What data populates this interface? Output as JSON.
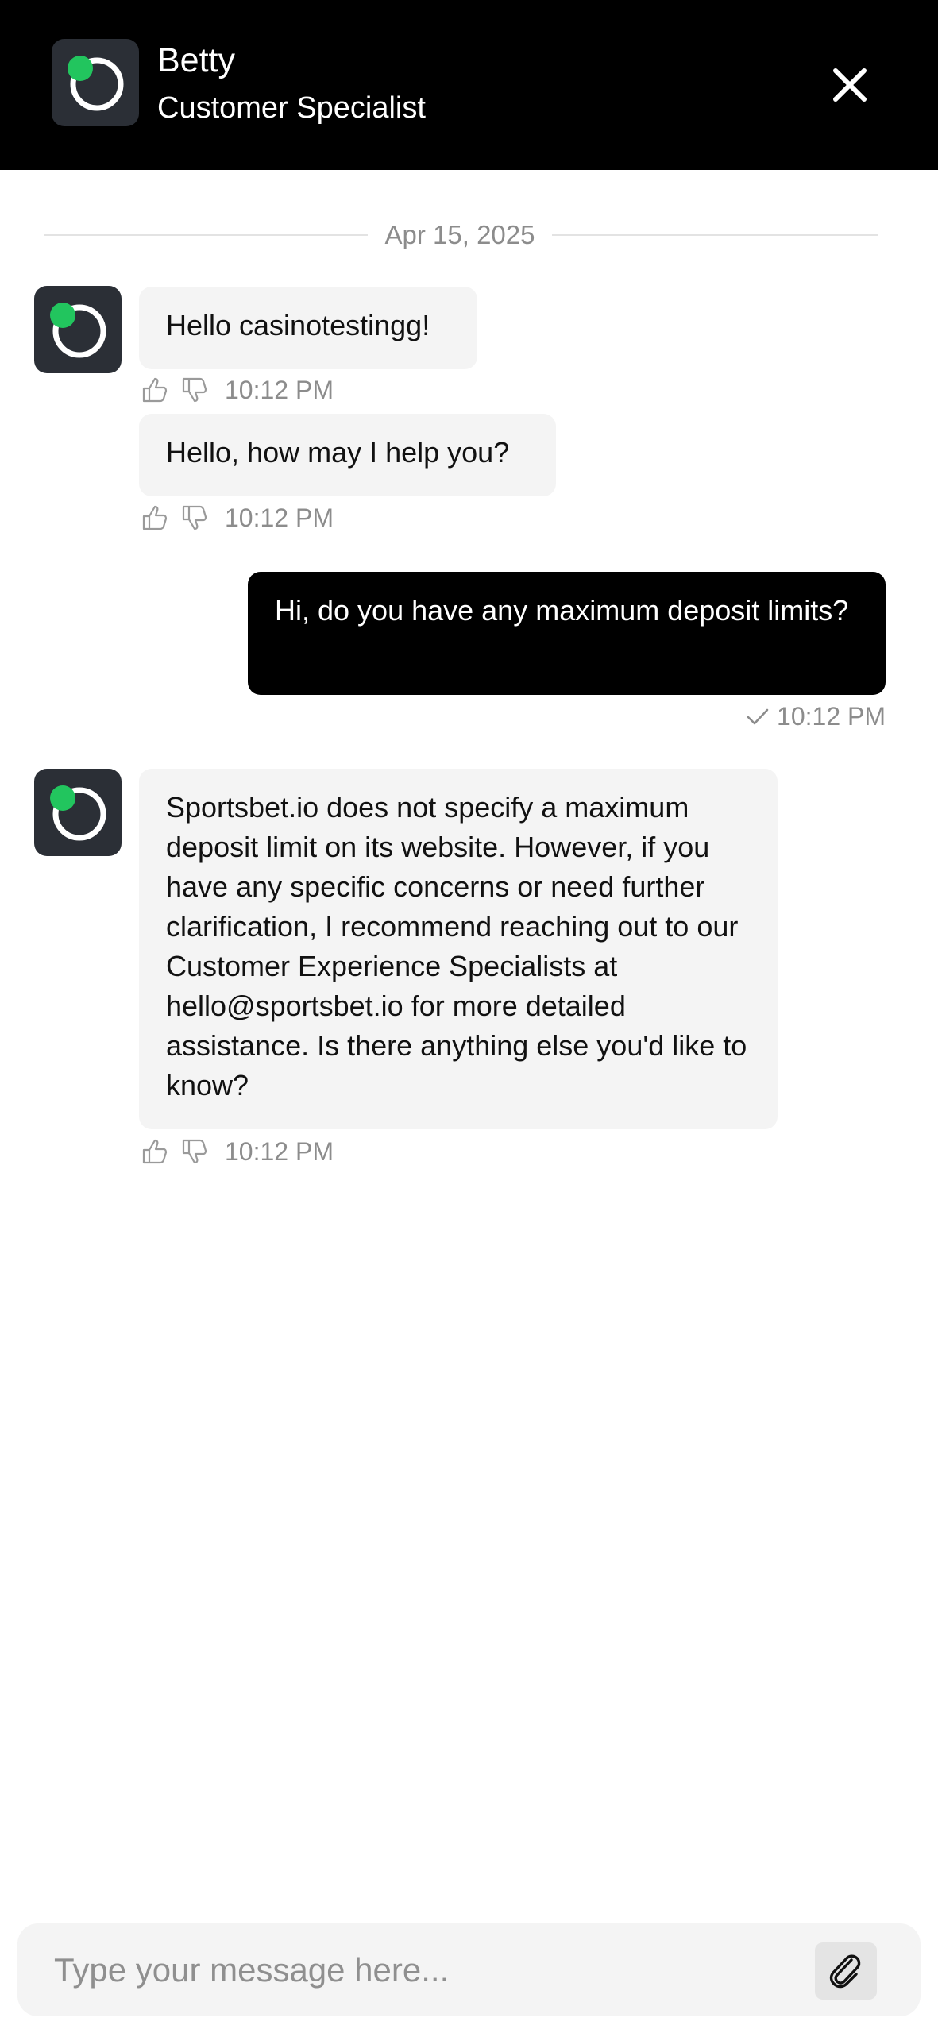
{
  "header": {
    "agent_name": "Betty",
    "agent_role": "Customer Specialist",
    "logo_icon": "spinner-ring-logo",
    "close_icon": "close-icon"
  },
  "divider": {
    "date": "Apr 15, 2025"
  },
  "messages": [
    {
      "sender": "agent",
      "text": "Hello casinotestingg!",
      "time": "10:12 PM"
    },
    {
      "sender": "agent",
      "text": "Hello, how may I help you?",
      "time": "10:12 PM"
    },
    {
      "sender": "user",
      "text": "Hi, do you have any maximum deposit limits?",
      "time": "10:12 PM",
      "status_icon": "checkmark-icon"
    },
    {
      "sender": "agent",
      "text": "Sportsbet.io does not specify a maximum deposit limit on its website. However, if you have any specific concerns or need further clarification, I recommend reaching out to our Customer Experience Specialists at hello@sportsbet.io for more detailed assistance. Is there anything else you'd like to know?",
      "time": "10:12 PM"
    }
  ],
  "composer": {
    "placeholder": "Type your message here...",
    "attach_icon": "paperclip-icon"
  },
  "colors": {
    "header_bg": "#000000",
    "logo_bg": "#2b2f36",
    "logo_accent": "#22c55e",
    "agent_bubble": "#f4f4f4",
    "user_bubble": "#000000",
    "muted_text": "#8c8c8c"
  }
}
